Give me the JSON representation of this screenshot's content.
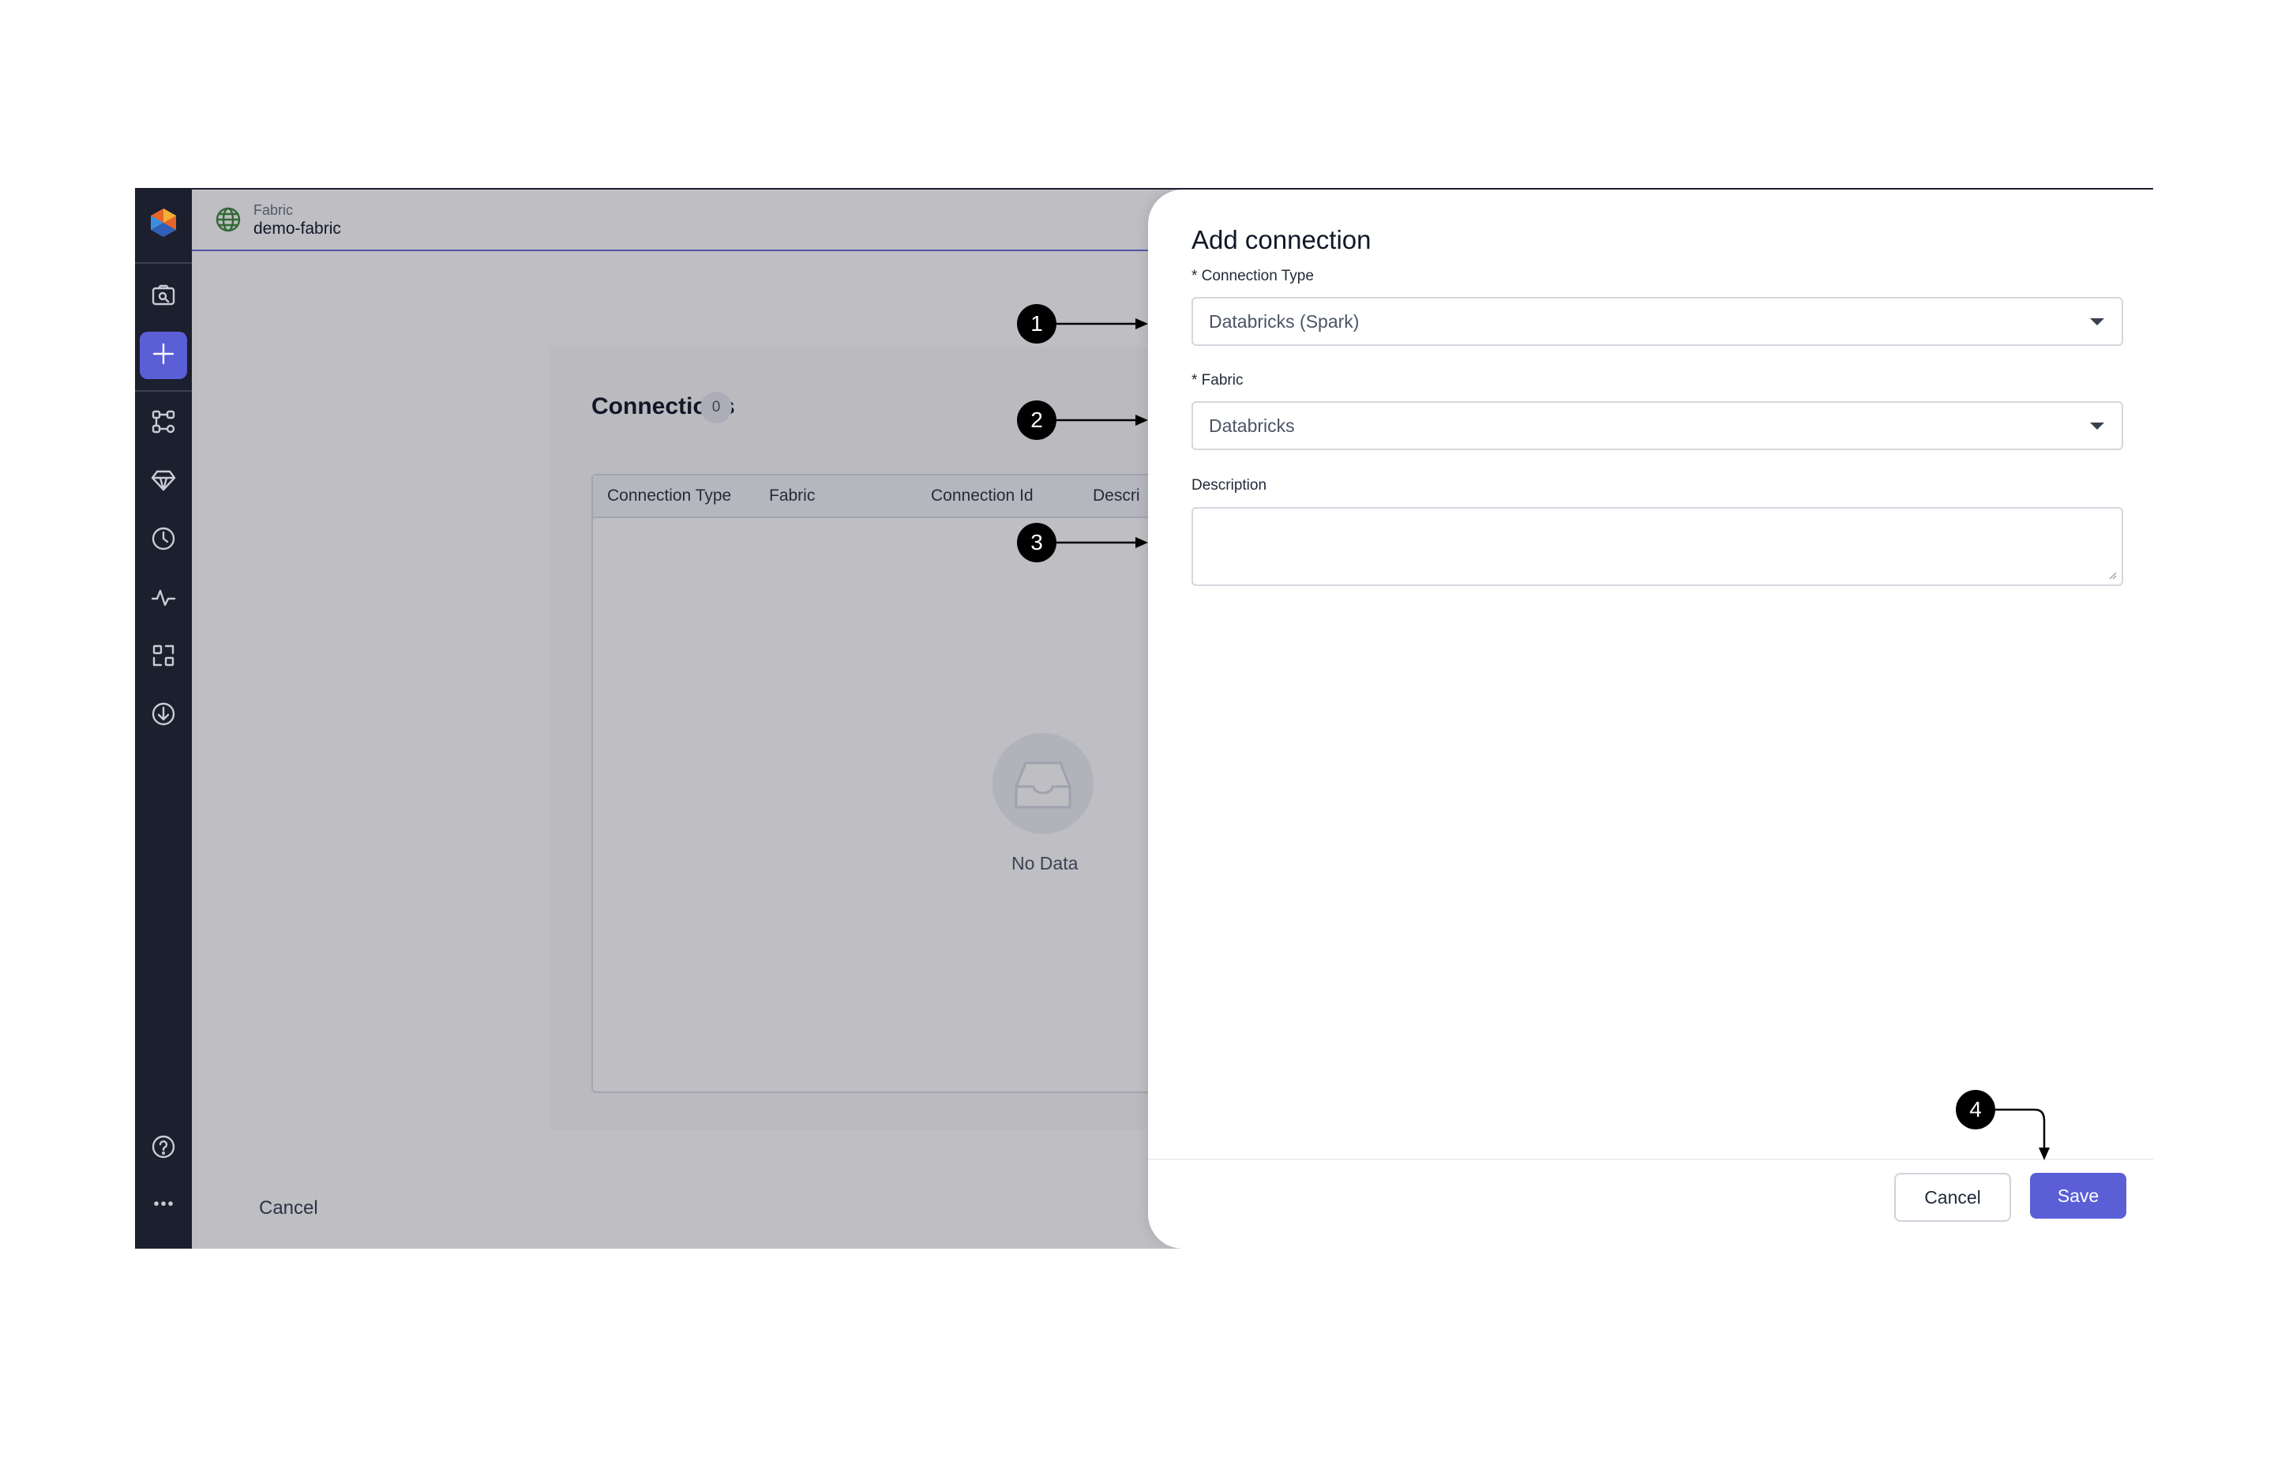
{
  "app": {
    "rail_icons": [
      "logo-icon",
      "folder-search-icon",
      "plus-icon",
      "graph-icon",
      "gem-icon",
      "clock-icon",
      "activity-icon",
      "scan-icon",
      "download-icon",
      "help-icon",
      "more-icon"
    ]
  },
  "topbar": {
    "entity_type": "Fabric",
    "entity_name": "demo-fabric"
  },
  "connections": {
    "title": "Connections",
    "count": "0",
    "columns": [
      "Connection Type",
      "Fabric",
      "Connection Id",
      "Descri"
    ],
    "empty_text": "No Data"
  },
  "main_footer": {
    "cancel_label": "Cancel"
  },
  "close_label": "×",
  "drawer": {
    "title": "Add connection",
    "connection_type_label": "* Connection Type",
    "connection_type_value": "Databricks (Spark)",
    "fabric_label": "* Fabric",
    "fabric_value": "Databricks",
    "description_label": "Description",
    "description_value": "",
    "cancel_label": "Cancel",
    "save_label": "Save"
  },
  "callouts": [
    "1",
    "2",
    "3",
    "4"
  ],
  "colors": {
    "accent": "#5b5fd6",
    "rail": "#1b1f2e"
  }
}
